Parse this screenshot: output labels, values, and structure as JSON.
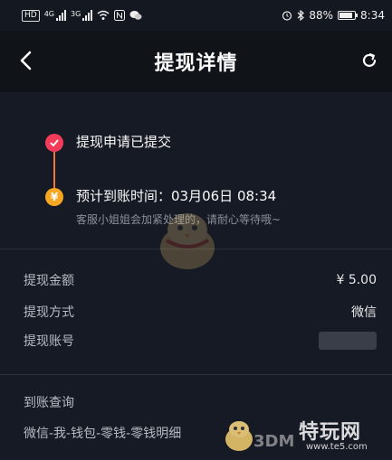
{
  "status_bar": {
    "left_chip": "HD",
    "net1": "4G",
    "net2": "3G",
    "battery": "88%",
    "time": "8:34"
  },
  "header": {
    "title": "提现详情"
  },
  "timeline": {
    "step1": {
      "label": "提现申请已提交"
    },
    "step2": {
      "icon_char": "¥",
      "label": "预计到账时间：03月06日 08:34",
      "sub": "客服小姐姐会加紧处理的，请耐心等待哦~"
    }
  },
  "details": {
    "amount_label": "提现金额",
    "amount_value": "¥ 5.00",
    "method_label": "提现方式",
    "method_value": "微信",
    "account_label": "提现账号"
  },
  "query": {
    "title": "到账查询",
    "path": "微信-我-钱包-零钱-零钱明细"
  },
  "watermark": {
    "brand": "3DM",
    "text": "特玩网",
    "sub": "www.te5.com"
  },
  "colors": {
    "background": "#141821",
    "step1": "#f23c5a",
    "step2": "#f5a623",
    "timeline_line": "#f0753a"
  },
  "icons": {
    "back": "chevron-left-icon",
    "refresh": "refresh-icon",
    "step1": "check-icon",
    "step2": "yen-icon"
  }
}
